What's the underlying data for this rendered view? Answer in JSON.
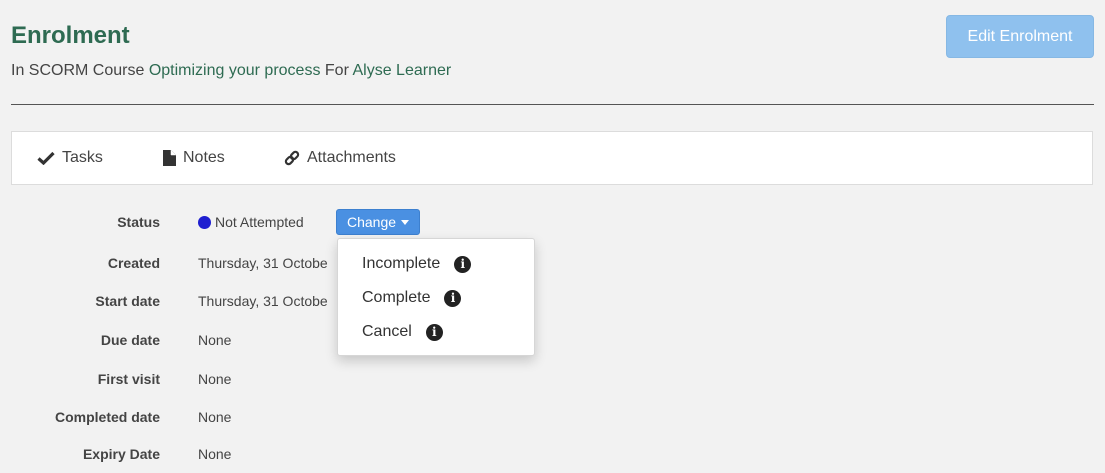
{
  "header": {
    "title": "Enrolment",
    "subtitle_prefix": "In SCORM Course",
    "course_link": "Optimizing your process",
    "subtitle_middle": "For",
    "learner_link": "Alyse Learner",
    "edit_button": "Edit Enrolment"
  },
  "tabs": [
    {
      "label": "Tasks",
      "icon": "check-icon"
    },
    {
      "label": "Notes",
      "icon": "document-icon"
    },
    {
      "label": "Attachments",
      "icon": "link-icon"
    }
  ],
  "details": {
    "status": {
      "label": "Status",
      "value": "Not Attempted",
      "dot_color": "#1f1fd0"
    },
    "change_button": "Change",
    "created": {
      "label": "Created",
      "value": "Thursday, 31 Octobe"
    },
    "start_date": {
      "label": "Start date",
      "value": "Thursday, 31 Octobe"
    },
    "due_date": {
      "label": "Due date",
      "value": "None"
    },
    "first_visit": {
      "label": "First visit",
      "value": "None"
    },
    "completed_date": {
      "label": "Completed date",
      "value": "None"
    },
    "expiry_date": {
      "label": "Expiry Date",
      "value": "None"
    }
  },
  "dropdown": {
    "items": [
      {
        "label": "Incomplete",
        "icon": "info-icon"
      },
      {
        "label": "Complete",
        "icon": "info-icon"
      },
      {
        "label": "Cancel",
        "icon": "info-icon"
      }
    ]
  },
  "colors": {
    "title_green": "#2e6b52",
    "edit_button_bg": "#8fc1ee",
    "change_button_bg": "#4a90e2"
  }
}
